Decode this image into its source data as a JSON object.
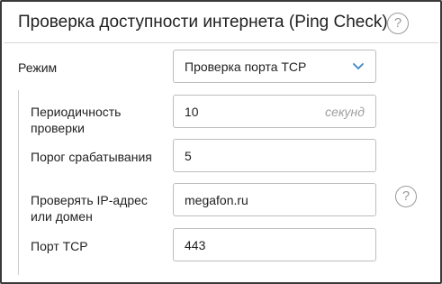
{
  "header": {
    "title": "Проверка доступности интернета (Ping Check)",
    "help_glyph": "?"
  },
  "mode": {
    "label": "Режим",
    "value": "Проверка порта TCP"
  },
  "settings": {
    "interval": {
      "label": "Периодичность проверки",
      "value": "10",
      "unit": "секунд"
    },
    "threshold": {
      "label": "Порог срабатывания",
      "value": "5"
    },
    "host": {
      "label": "Проверять IP-адрес или домен",
      "value": "megafon.ru",
      "help_glyph": "?"
    },
    "port": {
      "label": "Порт TCP",
      "value": "443"
    }
  },
  "colors": {
    "border": "#3a3a3a",
    "field_border": "#bdbdbd",
    "chevron": "#3c86c8",
    "muted": "#9e9e9e"
  }
}
